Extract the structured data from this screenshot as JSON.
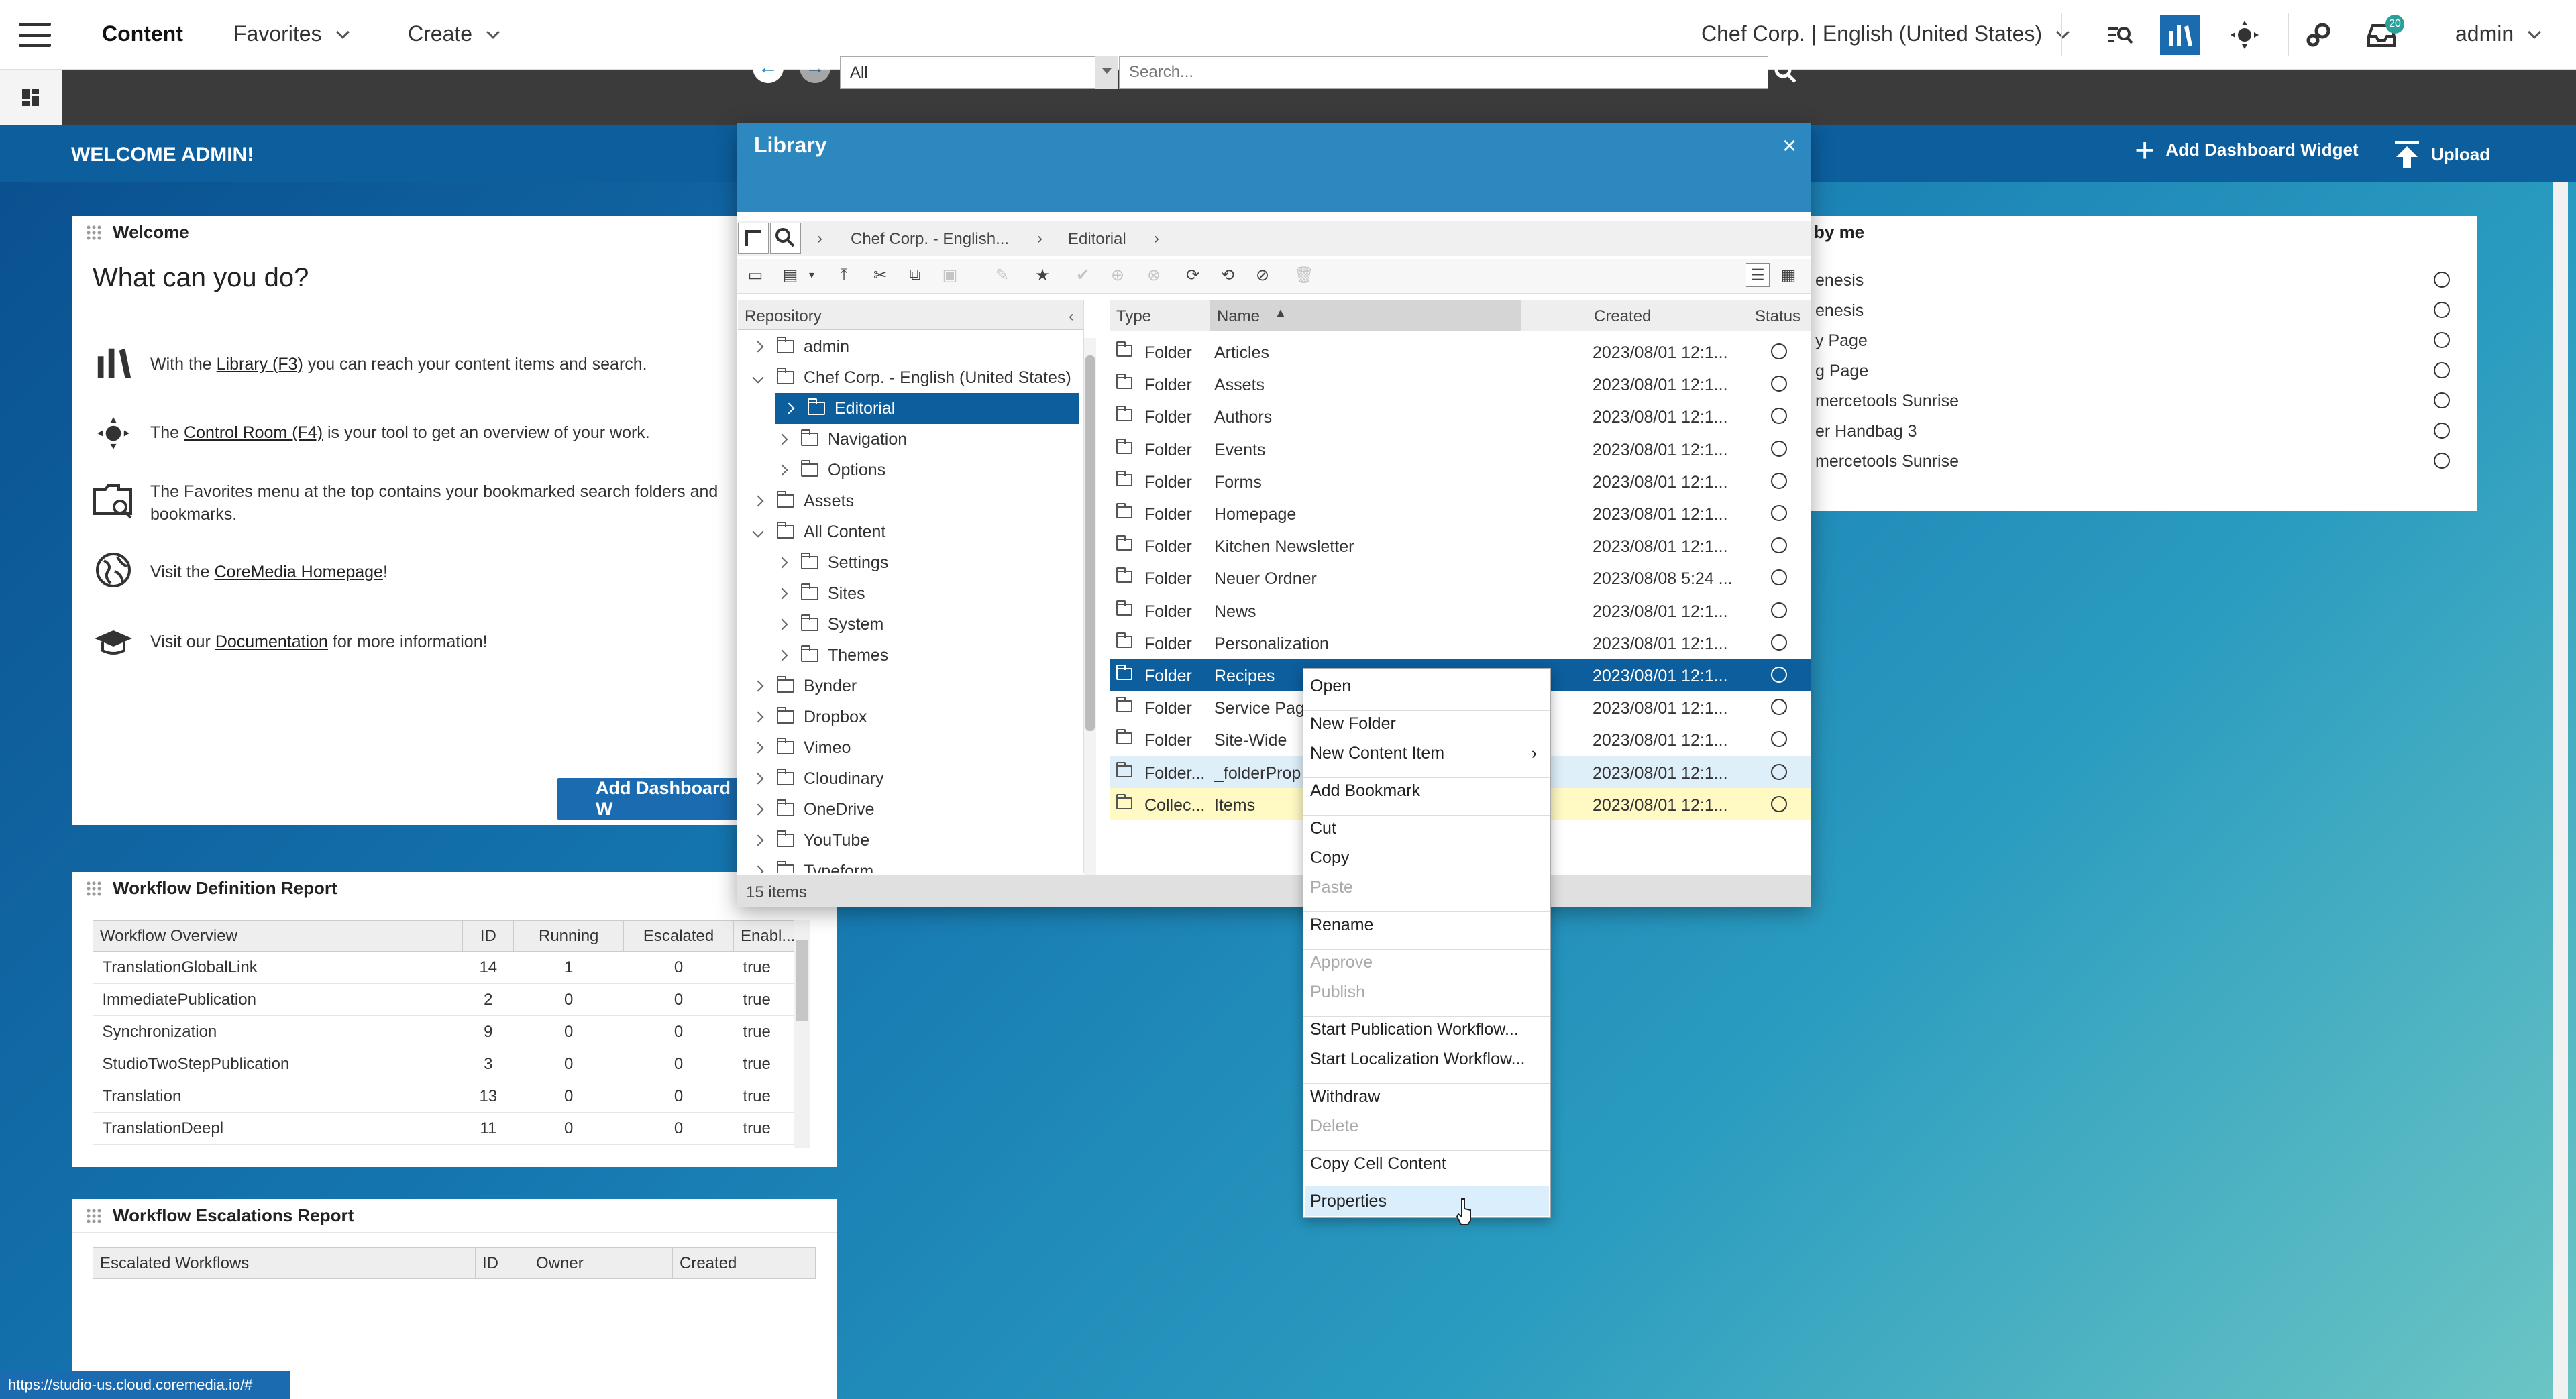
{
  "topbar": {
    "app": "Content",
    "favorites": "Favorites",
    "create": "Create",
    "site": "Chef Corp. | English (United States)",
    "user": "admin",
    "notification_count": "20"
  },
  "dashboard": {
    "welcome": "WELCOME ADMIN!",
    "add_widget": "Add Dashboard Widget",
    "upload": "Upload",
    "welcome_widget": {
      "title": "Welcome",
      "heading": "What can you do?",
      "items": [
        {
          "pre": "With the ",
          "link": "Library (F3)",
          "post": " you can reach your content items and search."
        },
        {
          "pre": "The ",
          "link": "Control Room (F4)",
          "post": " is your tool to get an overview of your work."
        },
        {
          "pre": "The Favorites menu at the top contains your bookmarked search folders and",
          "line2": "bookmarks."
        },
        {
          "pre": "Visit the ",
          "link": "CoreMedia Homepage",
          "post": "!"
        },
        {
          "pre": "Visit our ",
          "link": "Documentation",
          "post": " for more information!"
        }
      ],
      "button": "Add Dashboard W"
    },
    "workflow_def": {
      "title": "Workflow Definition Report",
      "columns": [
        "Workflow Overview",
        "ID",
        "Running",
        "Escalated",
        "Enabl..."
      ],
      "rows": [
        [
          "TranslationGlobalLink",
          "14",
          "1",
          "0",
          "true"
        ],
        [
          "ImmediatePublication",
          "2",
          "0",
          "0",
          "true"
        ],
        [
          "Synchronization",
          "9",
          "0",
          "0",
          "true"
        ],
        [
          "StudioTwoStepPublication",
          "3",
          "0",
          "0",
          "true"
        ],
        [
          "Translation",
          "13",
          "0",
          "0",
          "true"
        ],
        [
          "TranslationDeepl",
          "11",
          "0",
          "0",
          "true"
        ]
      ]
    },
    "workflow_esc": {
      "title": "Workflow Escalations Report",
      "columns": [
        "Escalated Workflows",
        "ID",
        "Owner",
        "Created"
      ]
    },
    "right_widget": {
      "title": "by me",
      "items": [
        "enesis",
        "enesis",
        "y Page",
        "g Page",
        "mercetools Sunrise",
        "er Handbag 3",
        "mercetools Sunrise"
      ]
    }
  },
  "library": {
    "title": "Library",
    "filter": "All",
    "search_placeholder": "Search...",
    "breadcrumb": [
      "Chef Corp. - English...",
      "Editorial"
    ],
    "tree_header": "Repository",
    "tree": [
      {
        "label": "admin",
        "indent": 0,
        "state": "closed"
      },
      {
        "label": "Chef Corp. - English (United States)",
        "indent": 0,
        "state": "open"
      },
      {
        "label": "Editorial",
        "indent": 1,
        "state": "closed",
        "selected": true
      },
      {
        "label": "Navigation",
        "indent": 1,
        "state": "closed"
      },
      {
        "label": "Options",
        "indent": 1,
        "state": "closed"
      },
      {
        "label": "Assets",
        "indent": 0,
        "state": "closed"
      },
      {
        "label": "All Content",
        "indent": 0,
        "state": "open"
      },
      {
        "label": "Settings",
        "indent": 1,
        "state": "closed"
      },
      {
        "label": "Sites",
        "indent": 1,
        "state": "closed"
      },
      {
        "label": "System",
        "indent": 1,
        "state": "closed"
      },
      {
        "label": "Themes",
        "indent": 1,
        "state": "closed"
      },
      {
        "label": "Bynder",
        "indent": 0,
        "state": "closed"
      },
      {
        "label": "Dropbox",
        "indent": 0,
        "state": "closed"
      },
      {
        "label": "Vimeo",
        "indent": 0,
        "state": "closed"
      },
      {
        "label": "Cloudinary",
        "indent": 0,
        "state": "closed"
      },
      {
        "label": "OneDrive",
        "indent": 0,
        "state": "closed"
      },
      {
        "label": "YouTube",
        "indent": 0,
        "state": "closed"
      },
      {
        "label": "Typeform",
        "indent": 0,
        "state": "closed"
      }
    ],
    "columns": {
      "type": "Type",
      "name": "Name",
      "created": "Created",
      "status": "Status"
    },
    "rows": [
      {
        "type": "Folder",
        "name": "Articles",
        "created": "2023/08/01 12:1..."
      },
      {
        "type": "Folder",
        "name": "Assets",
        "created": "2023/08/01 12:1..."
      },
      {
        "type": "Folder",
        "name": "Authors",
        "created": "2023/08/01 12:1..."
      },
      {
        "type": "Folder",
        "name": "Events",
        "created": "2023/08/01 12:1..."
      },
      {
        "type": "Folder",
        "name": "Forms",
        "created": "2023/08/01 12:1..."
      },
      {
        "type": "Folder",
        "name": "Homepage",
        "created": "2023/08/01 12:1..."
      },
      {
        "type": "Folder",
        "name": "Kitchen Newsletter",
        "created": "2023/08/01 12:1..."
      },
      {
        "type": "Folder",
        "name": "Neuer Ordner",
        "created": "2023/08/08 5:24 ..."
      },
      {
        "type": "Folder",
        "name": "News",
        "created": "2023/08/01 12:1..."
      },
      {
        "type": "Folder",
        "name": "Personalization",
        "created": "2023/08/01 12:1..."
      },
      {
        "type": "Folder",
        "name": "Recipes",
        "created": "2023/08/01 12:1...",
        "style": "sel"
      },
      {
        "type": "Folder",
        "name": "Service Pag",
        "created": "2023/08/01 12:1..."
      },
      {
        "type": "Folder",
        "name": "Site-Wide",
        "created": "2023/08/01 12:1..."
      },
      {
        "type": "Folder...",
        "name": "_folderProp",
        "created": "2023/08/01 12:1...",
        "style": "light"
      },
      {
        "type": "Collec...",
        "name": "Items",
        "created": "2023/08/01 12:1...",
        "style": "yellow"
      }
    ],
    "status": "15 items"
  },
  "context_menu": [
    {
      "label": "Open"
    },
    {
      "sep": true
    },
    {
      "label": "New Folder"
    },
    {
      "label": "New Content Item",
      "submenu": true
    },
    {
      "sep": true
    },
    {
      "label": "Add Bookmark"
    },
    {
      "sep": true
    },
    {
      "label": "Cut"
    },
    {
      "label": "Copy"
    },
    {
      "label": "Paste",
      "disabled": true
    },
    {
      "sep": true
    },
    {
      "label": "Rename"
    },
    {
      "sep": true
    },
    {
      "label": "Approve",
      "disabled": true
    },
    {
      "label": "Publish",
      "disabled": true
    },
    {
      "sep": true
    },
    {
      "label": "Start Publication Workflow..."
    },
    {
      "label": "Start Localization Workflow..."
    },
    {
      "sep": true
    },
    {
      "label": "Withdraw"
    },
    {
      "label": "Delete",
      "disabled": true
    },
    {
      "sep": true
    },
    {
      "label": "Copy Cell Content"
    },
    {
      "sep": true
    },
    {
      "label": "Properties",
      "highlighted": true
    }
  ],
  "status_url": "https://studio-us.cloud.coremedia.io/#"
}
